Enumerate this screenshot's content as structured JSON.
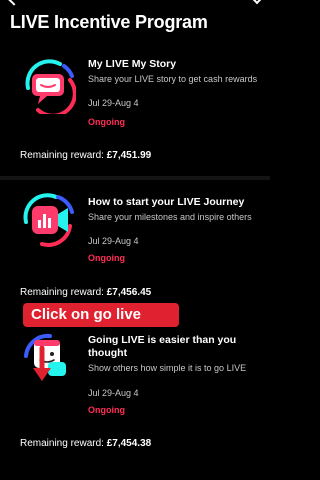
{
  "header": {
    "title": "LIVE Incentive Program"
  },
  "cards": [
    {
      "title": "My LIVE My Story",
      "desc": "Share your LIVE story to get cash rewards",
      "date": "Jul 29-Aug 4",
      "status": "Ongoing",
      "reward_label": "Remaining reward: ",
      "reward_value": "£7,451.99"
    },
    {
      "title": "How to start your LIVE Journey",
      "desc": "Share your milestones and inspire others",
      "date": "Jul 29-Aug 4",
      "status": "Ongoing",
      "reward_label": "Remaining reward: ",
      "reward_value": "£7,456.45"
    },
    {
      "title": "Going LIVE is easier than you thought",
      "desc": "Show others how simple it is to go LIVE",
      "date": "Jul 29-Aug 4",
      "status": "Ongoing",
      "reward_label": "Remaining reward: ",
      "reward_value": "£7,454.38"
    }
  ],
  "overlay": {
    "label": "Click on go live"
  },
  "colors": {
    "accent_red": "#ff2d55",
    "overlay_red": "#e0212f",
    "cyan": "#25f4ee",
    "background": "#000000"
  },
  "icons": [
    "back-chevron-icon",
    "chat-bubble-icon",
    "video-bars-icon",
    "calendar-icon",
    "down-arrow-icon"
  ]
}
